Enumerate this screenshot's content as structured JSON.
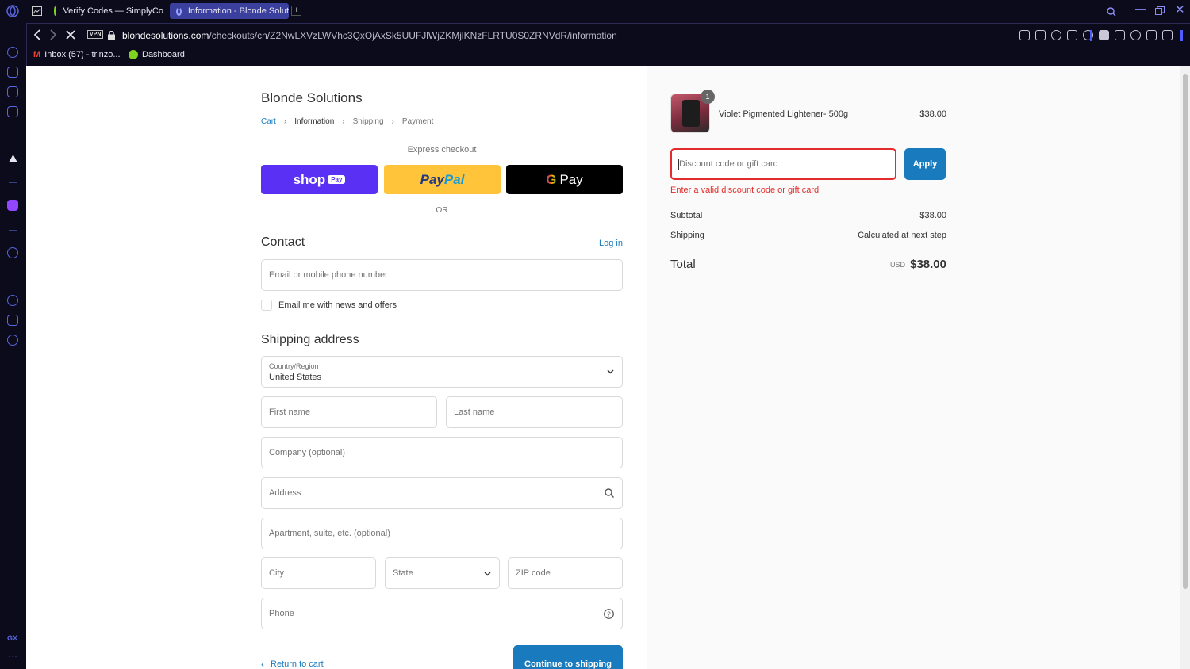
{
  "browser": {
    "tabs": [
      {
        "title": "Verify Codes — SimplyCo"
      },
      {
        "title": "Information - Blonde Solut"
      }
    ],
    "url_host": "blondesolutions.com",
    "url_path": "/checkouts/cn/Z2NwLXVzLWVhc3QxOjAxSk5UUFJlWjZKMjlKNzFLRTU0S0ZRNVdR/information",
    "vpn_label": "VPN",
    "bookmarks": [
      {
        "label": "Inbox (57) - trinzo..."
      },
      {
        "label": "Dashboard"
      }
    ]
  },
  "checkout": {
    "store_name": "Blonde Solutions",
    "breadcrumb": [
      "Cart",
      "Information",
      "Shipping",
      "Payment"
    ],
    "express_title": "Express checkout",
    "shop_pay_label": "shop",
    "shop_pay_badge": "Pay",
    "paypal_label_1": "Pay",
    "paypal_label_2": "Pal",
    "gpay_label": "Pay",
    "or_label": "OR",
    "contact_title": "Contact",
    "login_label": "Log in",
    "email_placeholder": "Email or mobile phone number",
    "news_label": "Email me with news and offers",
    "shipping_title": "Shipping address",
    "country_label": "Country/Region",
    "country_value": "United States",
    "first_name_placeholder": "First name",
    "last_name_placeholder": "Last name",
    "company_placeholder": "Company (optional)",
    "address_placeholder": "Address",
    "apartment_placeholder": "Apartment, suite, etc. (optional)",
    "city_placeholder": "City",
    "state_placeholder": "State",
    "zip_placeholder": "ZIP code",
    "phone_placeholder": "Phone",
    "return_label": "Return to cart",
    "continue_label": "Continue to shipping"
  },
  "summary": {
    "product_name": "Violet Pigmented Lightener- 500g",
    "product_price": "$38.00",
    "quantity": "1",
    "discount_placeholder": "Discount code or gift card",
    "apply_label": "Apply",
    "error_message": "Enter a valid discount code or gift card",
    "subtotal_label": "Subtotal",
    "subtotal_value": "$38.00",
    "shipping_label": "Shipping",
    "shipping_value": "Calculated at next step",
    "total_label": "Total",
    "currency": "USD",
    "total_value": "$38.00"
  },
  "colors": {
    "accent": "#197bbd",
    "error": "#e32c2b",
    "shop_pay": "#5a31f4",
    "paypal": "#ffc439"
  }
}
